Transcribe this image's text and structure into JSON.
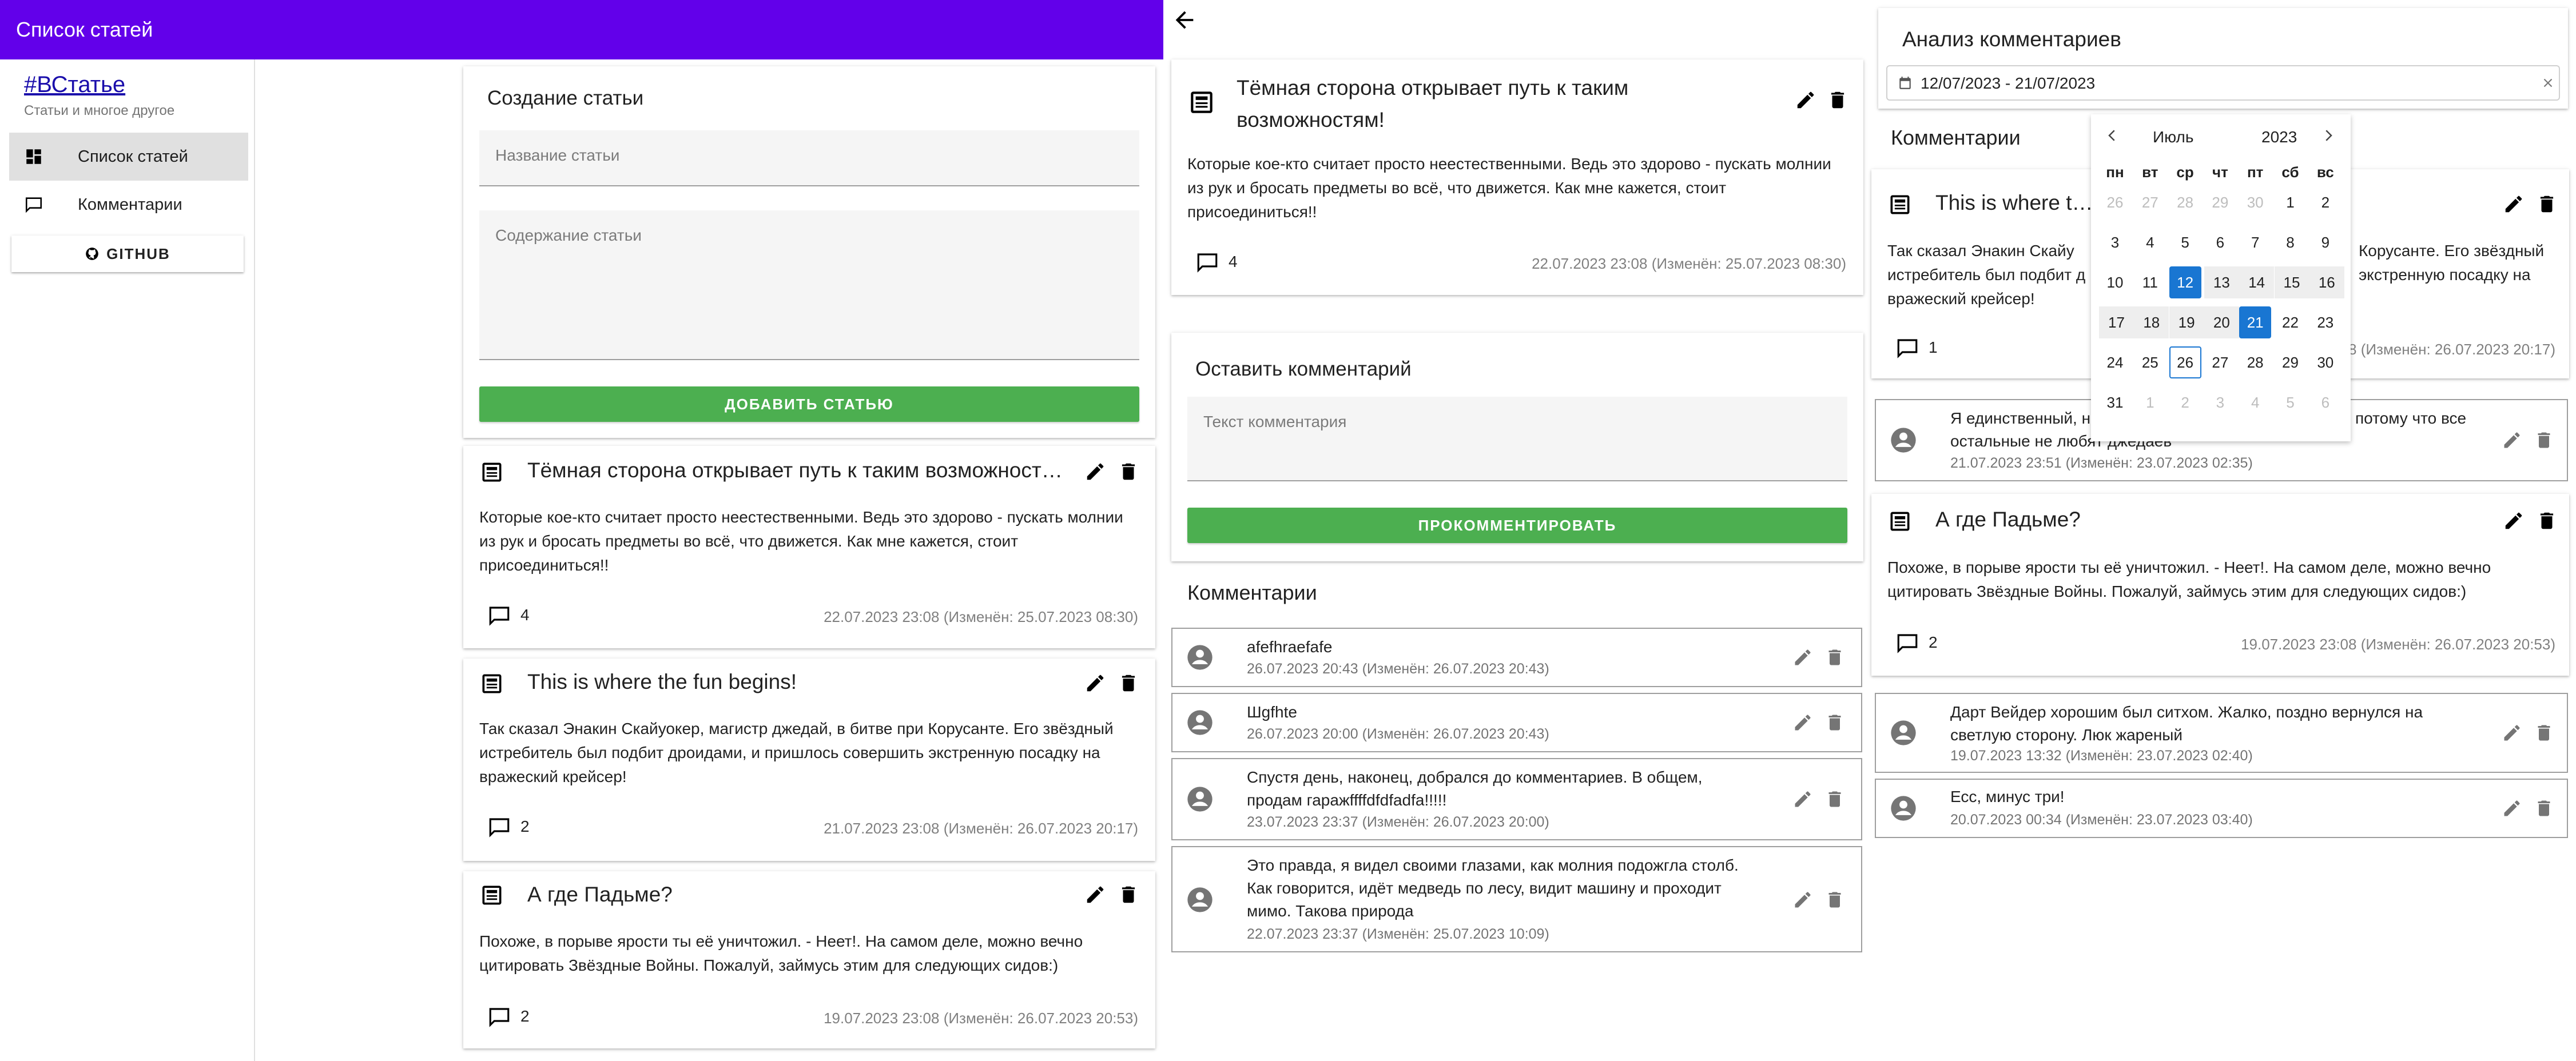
{
  "colors": {
    "appbar": "#6200ea",
    "green": "#4caf50",
    "selected": "#1976d2"
  },
  "pane1": {
    "appbar_title": "Список статей",
    "brand": "#ВСтатье",
    "brand_subtitle": "Статьи и многое другое",
    "nav": [
      {
        "label": "Список статей",
        "icon": "dashboard-icon"
      },
      {
        "label": "Комментарии",
        "icon": "comment-icon"
      }
    ],
    "github_label": "GITHUB",
    "create": {
      "title": "Создание статьи",
      "name_placeholder": "Название статьи",
      "content_placeholder": "Содержание статьи",
      "add_button": "ДОБАВИТЬ СТАТЬЮ"
    },
    "articles": [
      {
        "title": "Тёмная сторона открывает путь к таким возможностям!",
        "body": "Которые кое-кто считает просто неестественными. Ведь это здорово - пускать молнии из рук и бросать предметы во всё, что движется. Как мне кажется, стоит присоединиться!!",
        "comments": "4",
        "date": "22.07.2023 23:08 (Изменён: 25.07.2023 08:30)"
      },
      {
        "title": "This is where the fun begins!",
        "body": "Так сказал Энакин Скайуокер, магистр джедай, в битве при Корусанте. Его звёздный истребитель был подбит дроидами, и пришлось совершить экстренную посадку на вражеский крейсер!",
        "comments": "2",
        "date": "21.07.2023 23:08 (Изменён: 26.07.2023 20:17)"
      },
      {
        "title": "А где Падьме?",
        "body": "Похоже, в порыве ярости ты её уничтожил. - Неет!. На самом деле, можно вечно цитировать Звёздные Войны. Пожалуй, займусь этим для следующих сидов:)",
        "comments": "2",
        "date": "19.07.2023 23:08 (Изменён: 26.07.2023 20:53)"
      }
    ]
  },
  "pane2": {
    "article": {
      "title": "Тёмная сторона открывает путь к таким возможностям!",
      "body": "Которые кое-кто считает просто неестественными. Ведь это здорово - пускать молнии из рук и бросать предметы во всё, что движется. Как мне кажется, стоит присоединиться!!",
      "comments": "4",
      "date": "22.07.2023 23:08 (Изменён: 25.07.2023 08:30)"
    },
    "leave_comment_title": "Оставить комментарий",
    "comment_placeholder": "Текст комментария",
    "comment_button": "ПРОКОММЕНТИРОВАТЬ",
    "comments_title": "Комментарии",
    "comments": [
      {
        "text": "afefhraefafe",
        "date": "26.07.2023 20:43 (Изменён: 26.07.2023 20:43)"
      },
      {
        "text": "Шgfhte",
        "date": "26.07.2023 20:00 (Изменён: 26.07.2023 20:43)"
      },
      {
        "text": "Спустя день, наконец, добрался до комментариев. В общем, продам гаражffffdfdfadfa!!!!!",
        "date": "23.07.2023 23:37 (Изменён: 26.07.2023 20:00)"
      },
      {
        "text": "Это правда, я видел своими глазами, как молния подожгла столб. Как говорится, идёт медведь по лесу, видит машину и проходит мимо. Такова природа",
        "date": "22.07.2023 23:37 (Изменён: 25.07.2023 10:09)"
      }
    ]
  },
  "pane3": {
    "title": "Анализ комментариев",
    "date_range": "12/07/2023 - 21/07/2023",
    "comments_title": "Комментарии",
    "article1": {
      "title": "This is where the fun begins!",
      "body_left": "Так сказал Энакин Скайу",
      "body_right": "Корусанте. Его звёздный",
      "body_left2": "истребитель был подбит д",
      "body_right2": "экстренную посадку на",
      "body3": "вражеский крейсер!",
      "comments": "1",
      "date": "21.07.2023 23:08 (Изменён: 26.07.2023 20:17)"
    },
    "comment1": {
      "text_left": "Я единственный, н",
      "text_right": "потому что все",
      "text2": "остальные не любят джедаев",
      "date": "21.07.2023 23:51 (Изменён: 23.07.2023 02:35)"
    },
    "article2": {
      "title": "А где Падьме?",
      "body": "Похоже, в порыве ярости ты её уничтожил. - Неет!. На самом деле, можно вечно цитировать Звёздные Войны. Пожалуй, займусь этим для следующих сидов:)",
      "comments": "2",
      "date": "19.07.2023 23:08 (Изменён: 26.07.2023 20:53)"
    },
    "comments": [
      {
        "text": "Дарт Вейдер хорошим был ситхом. Жалко, поздно вернулся на светлую сторону. Люк жареный",
        "date": "19.07.2023 13:32 (Изменён: 23.07.2023 02:40)"
      },
      {
        "text": "Есс, минус три!",
        "date": "20.07.2023 00:34 (Изменён: 23.07.2023 03:40)"
      }
    ],
    "calendar": {
      "month": "Июль",
      "year": "2023",
      "weekdays": [
        "пн",
        "вт",
        "ср",
        "чт",
        "пт",
        "сб",
        "вс"
      ],
      "weeks": [
        [
          "26",
          "27",
          "28",
          "29",
          "30",
          "1",
          "2"
        ],
        [
          "3",
          "4",
          "5",
          "6",
          "7",
          "8",
          "9"
        ],
        [
          "10",
          "11",
          "12",
          "13",
          "14",
          "15",
          "16"
        ],
        [
          "17",
          "18",
          "19",
          "20",
          "21",
          "22",
          "23"
        ],
        [
          "24",
          "25",
          "26",
          "27",
          "28",
          "29",
          "30"
        ],
        [
          "31",
          "1",
          "2",
          "3",
          "4",
          "5",
          "6"
        ]
      ],
      "range_start": "12",
      "range_end": "21",
      "today": "26"
    }
  }
}
